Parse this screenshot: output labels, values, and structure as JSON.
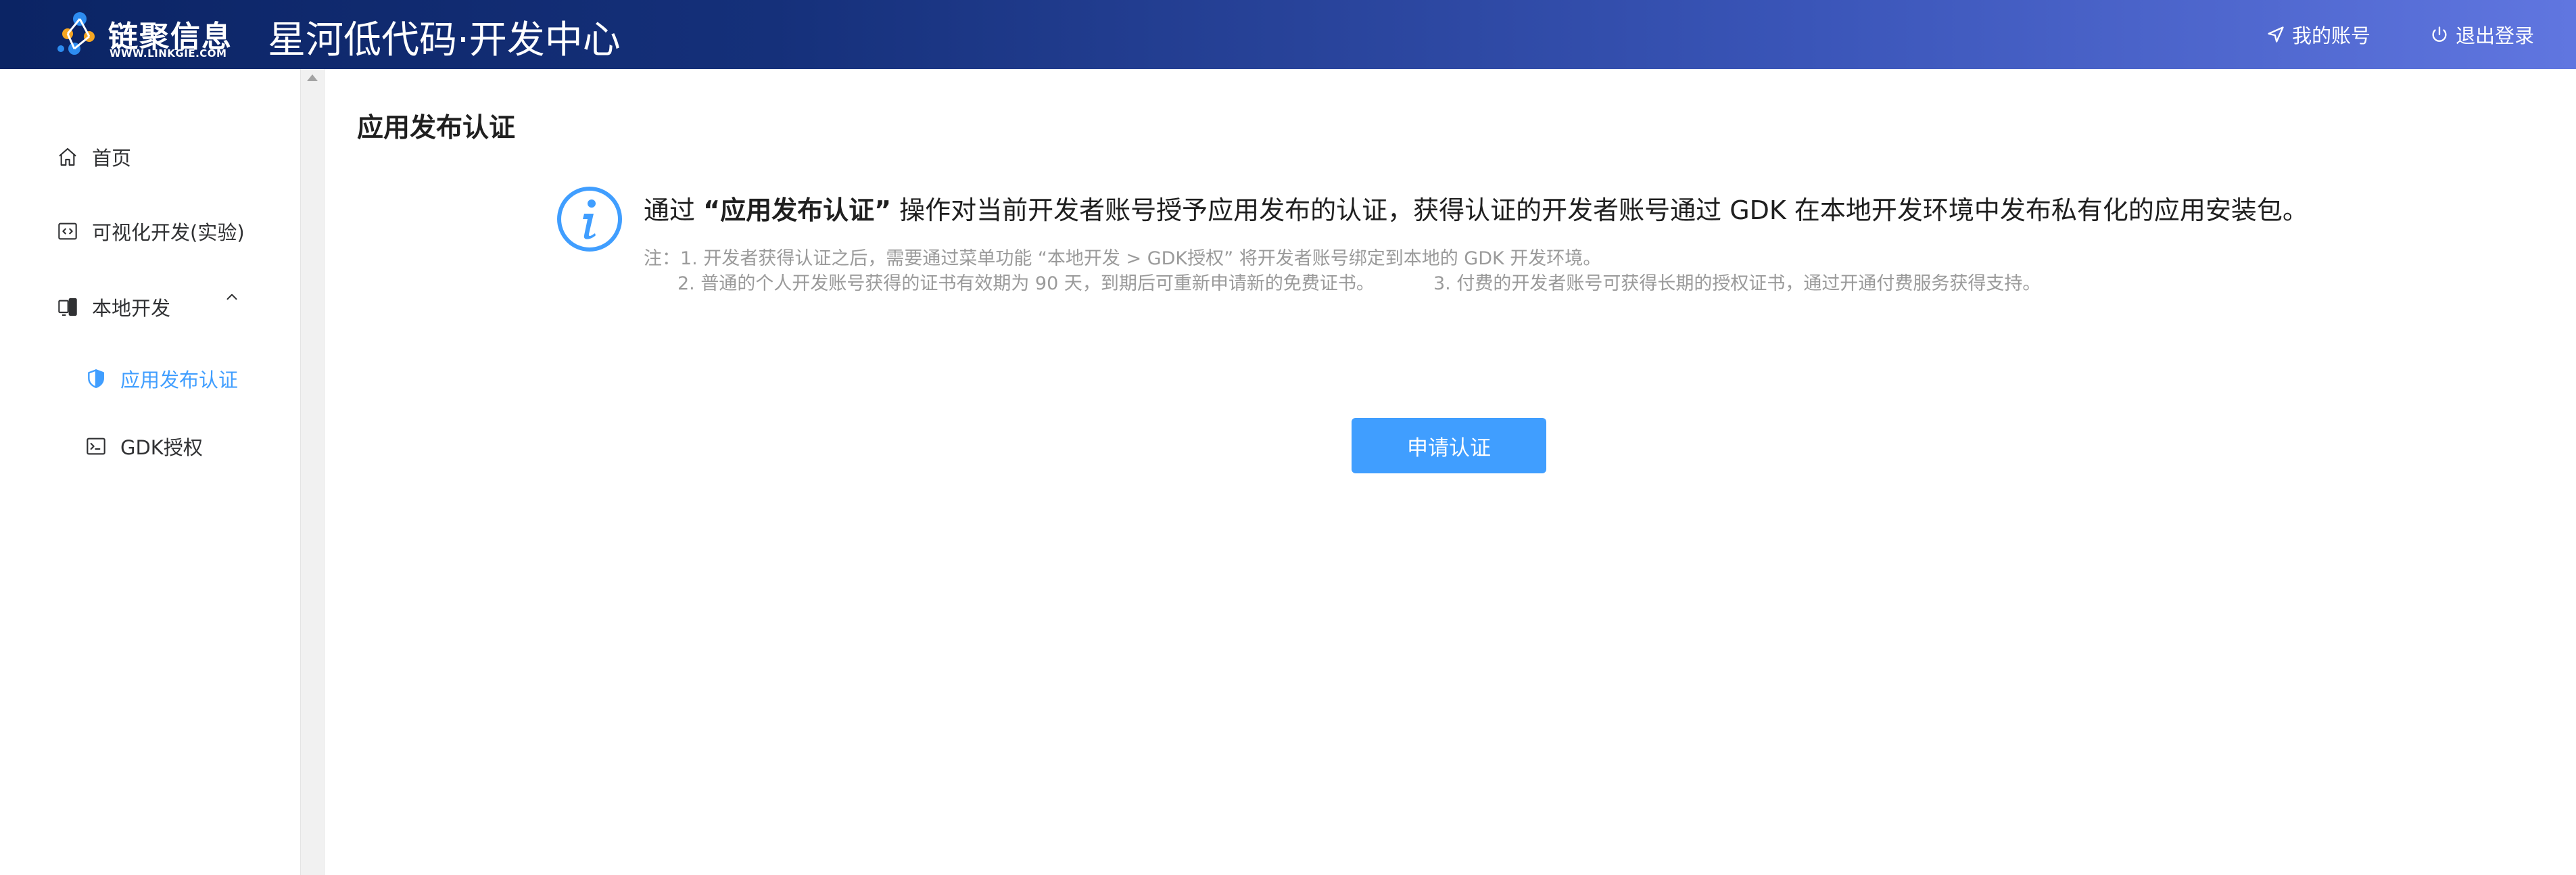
{
  "header": {
    "logo_cn": "链聚信息",
    "logo_en": "WWW.LINKGIE.COM",
    "app_title": "星河低代码·开发中心",
    "my_account": "我的账号",
    "logout": "退出登录"
  },
  "sidebar": {
    "items": [
      {
        "label": "首页",
        "icon": "home-icon"
      },
      {
        "label": "可视化开发(实验)",
        "icon": "code-icon"
      },
      {
        "label": "本地开发",
        "icon": "device-icon",
        "expanded": true
      },
      {
        "label": "应用发布认证",
        "icon": "shield-icon",
        "active": true
      },
      {
        "label": "GDK授权",
        "icon": "terminal-icon"
      }
    ]
  },
  "main": {
    "page_title": "应用发布认证",
    "info": {
      "prefix": "通过 ",
      "highlight": "“应用发布认证”",
      "suffix": " 操作对当前开发者账号授予应用发布的认证，获得认证的开发者账号通过 GDK 在本地开发环境中发布私有化的应用安装包。",
      "note1": "注：1. 开发者获得认证之后，需要通过菜单功能 “本地开发 > GDK授权” 将开发者账号绑定到本地的 GDK 开发环境。",
      "note2": "2. 普通的个人开发账号获得的证书有效期为 90 天，到期后可重新申请新的免费证书。",
      "note3": "3. 付费的开发者账号可获得长期的授权证书，通过开通付费服务获得支持。"
    },
    "apply_button": "申请认证"
  },
  "colors": {
    "accent": "#409eff",
    "header_start": "#0b2464",
    "header_end": "#6076e0"
  }
}
